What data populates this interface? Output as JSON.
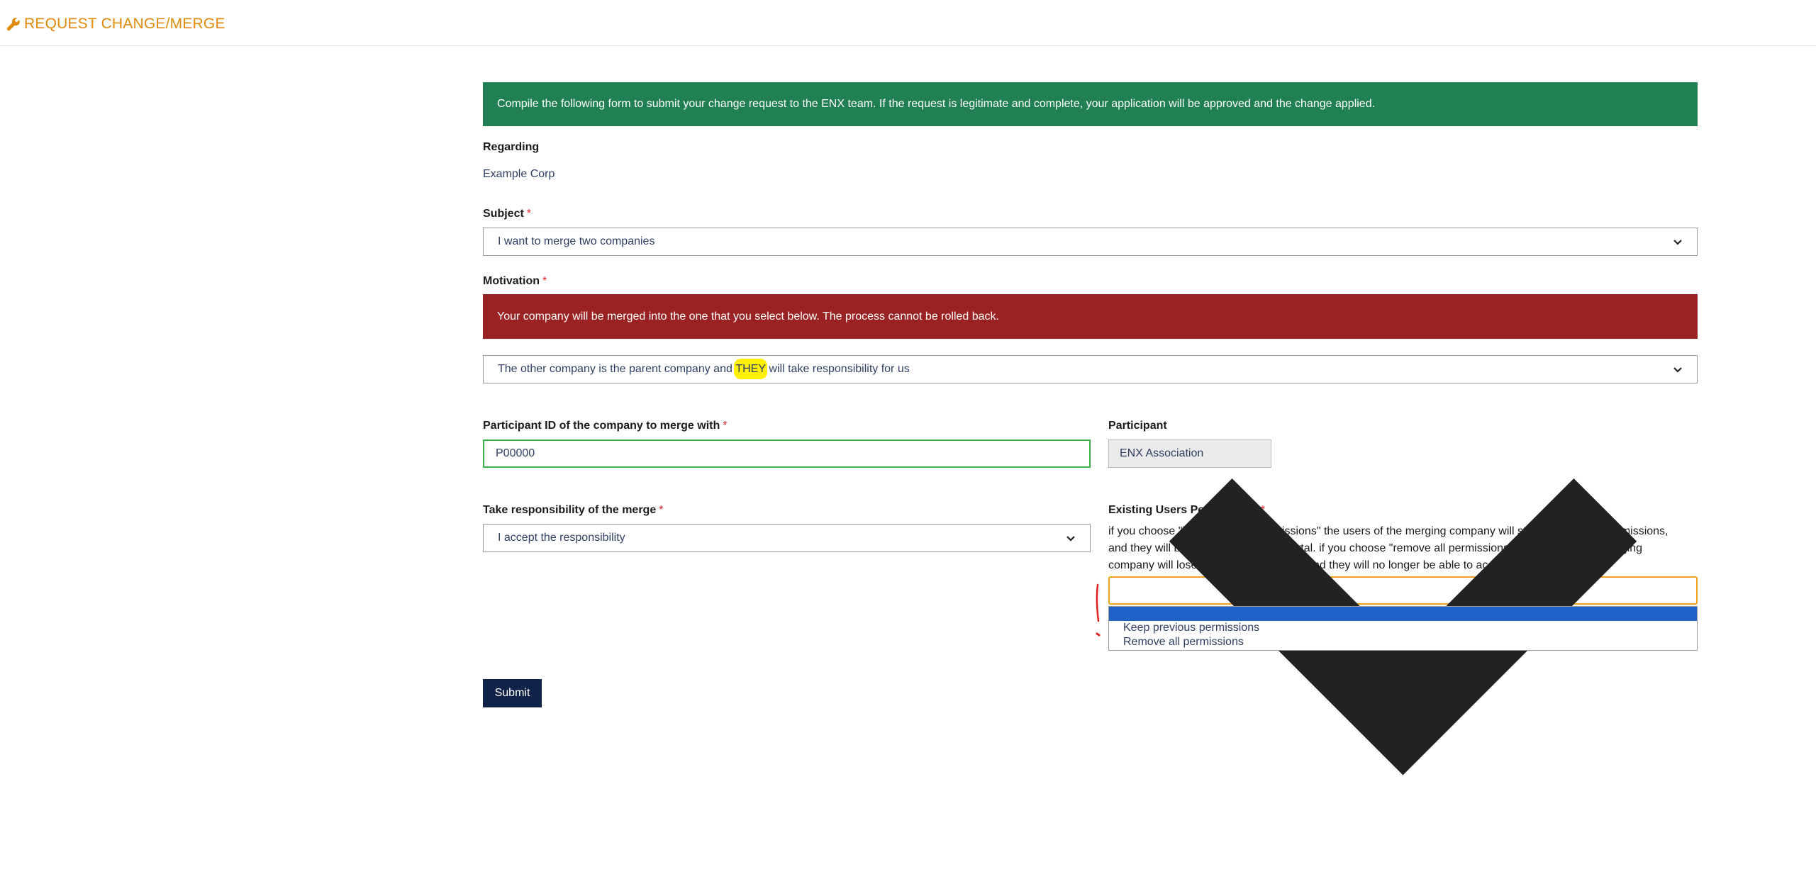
{
  "header": {
    "title": "REQUEST CHANGE/MERGE",
    "icon": "wrench-icon",
    "accent": "#e08a0b"
  },
  "info_banner": "Compile the following form to submit your change request to the ENX team. If the request is legitimate and complete, your application will be approved and the change applied.",
  "regarding": {
    "label": "Regarding",
    "value": "Example Corp"
  },
  "subject": {
    "label": "Subject",
    "required": "*",
    "selected": "I want to merge two companies"
  },
  "motivation": {
    "label": "Motivation",
    "required": "*",
    "warning": "Your company will be merged into the one that you select below. The process cannot be rolled back.",
    "selected_before": "The other company is the parent company and ",
    "selected_highlight": "THEY",
    "selected_after": " will take responsibility for us"
  },
  "participant_id": {
    "label": "Participant ID of the company to merge with",
    "required": "*",
    "value": "P00000"
  },
  "participant": {
    "label": "Participant",
    "value": "ENX Association"
  },
  "responsibility": {
    "label": "Take responsibility of the merge",
    "required": "*",
    "selected": "I accept the responsibility"
  },
  "permissions": {
    "label": "Existing Users Permissions",
    "required": "*",
    "help_lines": [
      "if you choose \"keep previous permissions\" the users of the merging company will still have all their permissions,",
      "and they will be able to access the portal. if you choose \"remove all permissions\" the ursers of the merging",
      "company will lose all their permissions, and they will no longer be able to access the portal."
    ],
    "selected": "",
    "options": [
      "Keep previous permissions",
      "Remove all permissions"
    ]
  },
  "submit_label": "Submit",
  "colors": {
    "info": "#218052",
    "danger": "#9a2222",
    "submit": "#0f2247",
    "valid_border": "#3cb14a",
    "focus_border": "#f1a11f",
    "option_highlight": "#1f63c9",
    "annotation": "#e0201c",
    "marker": "#fff100"
  }
}
